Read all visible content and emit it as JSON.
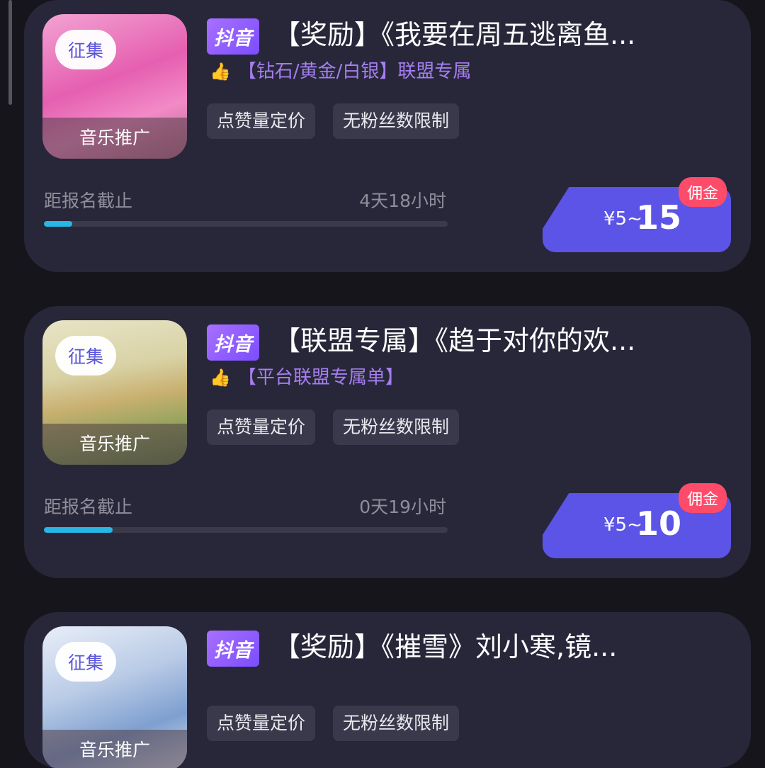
{
  "cards": [
    {
      "thumb_chip": "征集",
      "thumb_caption": "音乐推广",
      "platform_badge": "抖音",
      "title": "【奖励】《我要在周五逃离鱼...",
      "tier_line": "【钻石/黄金/白银】联盟专属",
      "tags": [
        "点赞量定价",
        "无粉丝数限制"
      ],
      "deadline_label": "距报名截止",
      "time_left": "4天18小时",
      "progress": 0.07,
      "price_prefix": "¥5~",
      "price_max": "15",
      "commission_label": "佣金",
      "thumb_icon": "thumbs-up-icon"
    },
    {
      "thumb_chip": "征集",
      "thumb_caption": "音乐推广",
      "platform_badge": "抖音",
      "title": "【联盟专属】《趋于对你的欢...",
      "tier_line": "【平台联盟专属单】",
      "tags": [
        "点赞量定价",
        "无粉丝数限制"
      ],
      "deadline_label": "距报名截止",
      "time_left": "0天19小时",
      "progress": 0.17,
      "price_prefix": "¥5~",
      "price_max": "10",
      "commission_label": "佣金",
      "thumb_icon": "thumbs-up-icon"
    },
    {
      "thumb_chip": "征集",
      "thumb_caption": "音乐推广",
      "platform_badge": "抖音",
      "title": "【奖励】《摧雪》刘小寒,镜...",
      "tags": [
        "点赞量定价",
        "无粉丝数限制"
      ]
    }
  ],
  "colors": {
    "page_bg": "#16151c",
    "card_bg": "#28273a",
    "accent_purple": "#a57ef0",
    "price_bg": "#5b54e6",
    "progress_fill": "#28b6e6",
    "commission_badge": "#ff4b6a"
  }
}
